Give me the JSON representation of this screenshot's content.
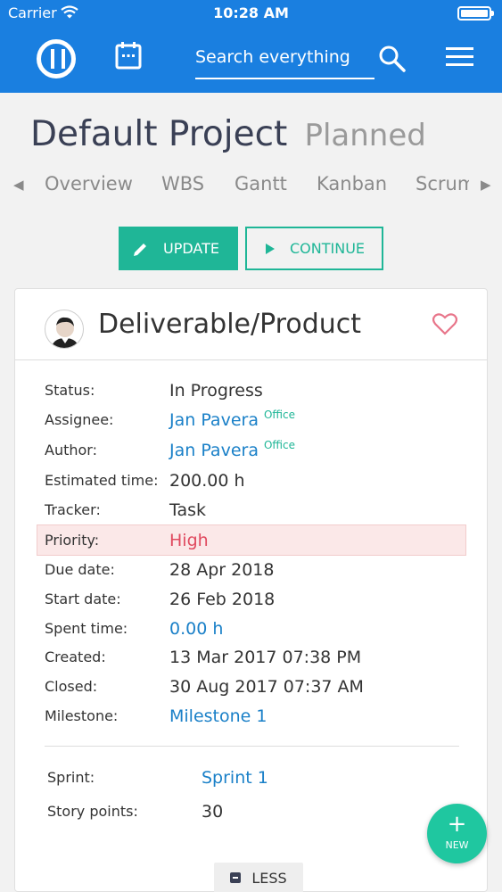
{
  "status_bar": {
    "carrier": "Carrier",
    "time": "10:28 AM"
  },
  "header": {
    "search_placeholder": "Search everything"
  },
  "project": {
    "name": "Default Project",
    "state": "Planned"
  },
  "tabs": [
    "Overview",
    "WBS",
    "Gantt",
    "Kanban",
    "Scrum"
  ],
  "actions": {
    "update": "UPDATE",
    "continue": "CONTINUE"
  },
  "card": {
    "title": "Deliverable/Product",
    "fields": {
      "status": {
        "label": "Status:",
        "value": "In Progress"
      },
      "assignee": {
        "label": "Assignee:",
        "value": "Jan Pavera",
        "tag": "Office"
      },
      "author": {
        "label": "Author:",
        "value": "Jan Pavera",
        "tag": "Office"
      },
      "estimated": {
        "label": "Estimated time:",
        "value": "200.00 h"
      },
      "tracker": {
        "label": "Tracker:",
        "value": "Task"
      },
      "priority": {
        "label": "Priority:",
        "value": "High"
      },
      "due": {
        "label": "Due date:",
        "value": "28 Apr 2018"
      },
      "start": {
        "label": "Start date:",
        "value": "26 Feb 2018"
      },
      "spent": {
        "label": "Spent time:",
        "value": "0.00 h"
      },
      "created": {
        "label": "Created:",
        "value": "13 Mar 2017 07:38 PM"
      },
      "closed": {
        "label": "Closed:",
        "value": "30 Aug 2017 07:37 AM"
      },
      "milestone": {
        "label": "Milestone:",
        "value": "Milestone 1"
      }
    },
    "sprint": {
      "label": "Sprint:",
      "value": "Sprint 1"
    },
    "story_points": {
      "label": "Story points:",
      "value": "30"
    },
    "less_label": "LESS"
  },
  "fab": {
    "plus": "+",
    "label": "NEW"
  },
  "colors": {
    "header": "#1a7fe0",
    "accent": "#1fb697",
    "link": "#1a80c8",
    "priority_high": "#e04a5f"
  },
  "icons": [
    "wifi-icon",
    "battery-icon",
    "app-logo-icon",
    "calendar-icon",
    "search-icon",
    "menu-icon",
    "pencil-icon",
    "play-icon",
    "heart-icon",
    "collapse-icon"
  ]
}
